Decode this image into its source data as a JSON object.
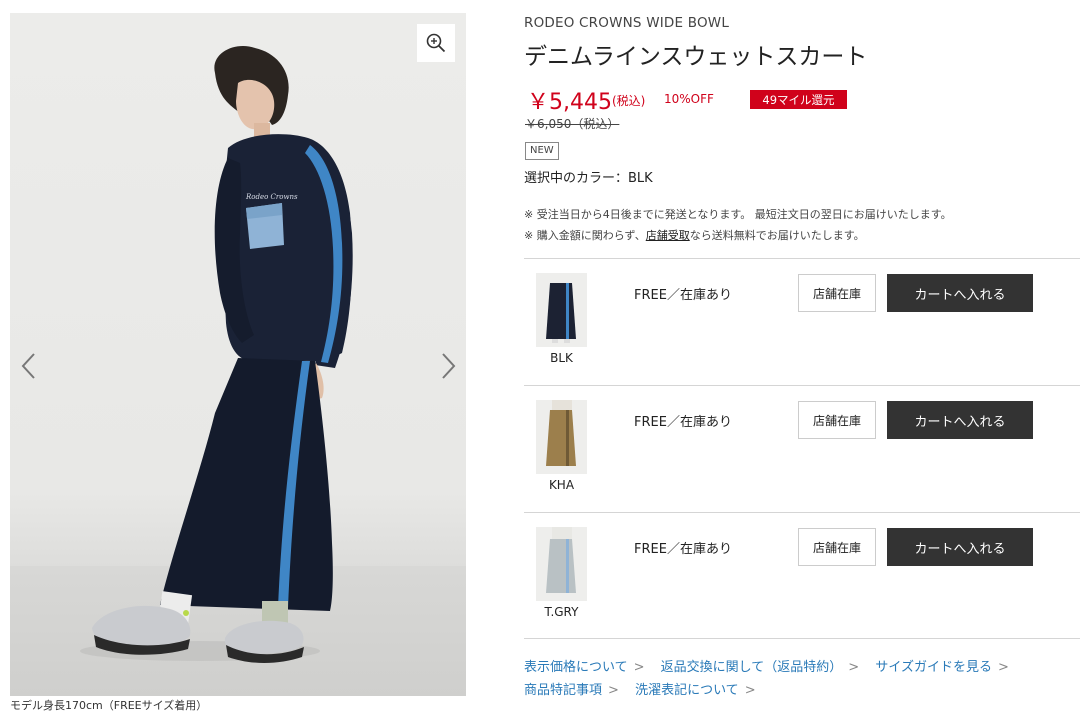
{
  "gallery": {
    "zoom_icon": "zoom-in-icon",
    "prev_icon": "chevron-left-icon",
    "next_icon": "chevron-right-icon",
    "caption": "モデル身長170cm（FREEサイズ着用）"
  },
  "product": {
    "brand": "RODEO CROWNS WIDE BOWL",
    "title": "デニムラインスウェットスカート",
    "price": "￥5,445",
    "tax_label": "(税込)",
    "discount": "10%OFF",
    "miles_badge": "49マイル還元",
    "old_price": "￥6,050（税込）",
    "new_badge": "NEW",
    "selected_color_label": "選択中のカラー：BLK",
    "note1": "※ 受注当日から4日後までに発送となります。 最短注文日の翌日にお届けいたします。",
    "note2_prefix": "※ 購入金額に関わらず、",
    "note2_link": "店舗受取",
    "note2_suffix": "なら送料無料でお届けいたします。"
  },
  "variants": [
    {
      "color": "BLK",
      "stock": "FREE／在庫あり",
      "store_label": "店舗在庫",
      "cart_label": "カートへ入れる",
      "swatch": "#1c2233"
    },
    {
      "color": "KHA",
      "stock": "FREE／在庫あり",
      "store_label": "店舗在庫",
      "cart_label": "カートへ入れる",
      "swatch": "#9c7f4c"
    },
    {
      "color": "T.GRY",
      "stock": "FREE／在庫あり",
      "store_label": "店舗在庫",
      "cart_label": "カートへ入れる",
      "swatch": "#b9c1c4"
    }
  ],
  "links": {
    "price_display": "表示価格について",
    "returns": "返品交換に関して（返品特約）",
    "size_guide": "サイズガイドを見る",
    "commerce_law": "商品特記事項",
    "care_label": "洗濯表記について",
    "chevron": ">"
  },
  "colors": {
    "accent_red": "#d0021b",
    "dark_button": "#333333",
    "link_blue": "#2a7ab8"
  }
}
